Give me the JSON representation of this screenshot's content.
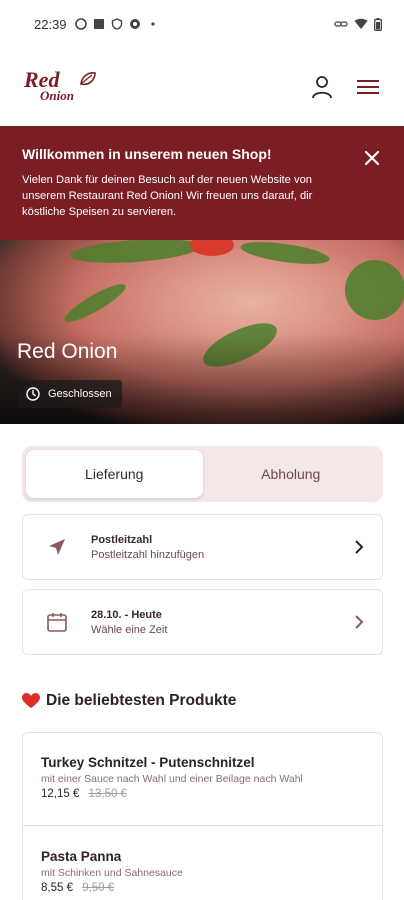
{
  "status_bar": {
    "time": "22:39"
  },
  "header": {
    "logo_line1": "Red",
    "logo_line2": "Onion"
  },
  "banner": {
    "title": "Willkommen in unserem neuen Shop!",
    "text": "Vielen Dank für deinen Besuch auf der neuen Website von unserem Restaurant Red Onion! Wir freuen uns darauf, dir köstliche Speisen zu servieren."
  },
  "hero": {
    "restaurant_name": "Red Onion",
    "status": "Geschlossen"
  },
  "order_mode": {
    "options": [
      "Lieferung",
      "Abholung"
    ],
    "selected": "Lieferung"
  },
  "postcode_card": {
    "title": "Postleitzahl",
    "subtitle": "Postleitzahl hinzufügen"
  },
  "time_card": {
    "title": "28.10. - Heute",
    "subtitle": "Wähle eine Zeit"
  },
  "popular": {
    "title": "Die beliebtesten Produkte",
    "products": [
      {
        "name": "Turkey Schnitzel - Putenschnitzel",
        "description": "mit einer Sauce nach Wahl und einer Beilage nach Wahl",
        "price": "12,15 €",
        "old_price": "13,50 €"
      },
      {
        "name": "Pasta Panna",
        "description": "mit Schinken und Sahnesauce",
        "price": "8,55 €",
        "old_price": "9,50 €"
      }
    ]
  },
  "colors": {
    "brand": "#7a1d24",
    "toggle_bg": "#f4e7e8",
    "heart": "#e02b2b"
  }
}
